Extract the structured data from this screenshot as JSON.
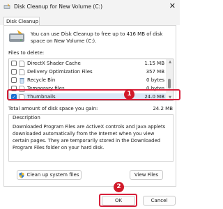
{
  "window": {
    "title": "Disk Cleanup for New Volume (C:)",
    "close_glyph": "✕"
  },
  "tabs": [
    {
      "label": "Disk Cleanup"
    }
  ],
  "intro_text": "You can use Disk Cleanup to free up to 416 MB of disk space on New Volume (C:).",
  "files_label": "Files to delete:",
  "files": [
    {
      "name": "DirectX Shader Cache",
      "size": "1.15 MB",
      "checked": false,
      "icon": "file-icon"
    },
    {
      "name": "Delivery Optimization Files",
      "size": "357 MB",
      "checked": false,
      "icon": "file-icon"
    },
    {
      "name": "Recycle Bin",
      "size": "0 bytes",
      "checked": false,
      "icon": "recycle-bin-icon"
    },
    {
      "name": "Temporary files",
      "size": "0 bytes",
      "checked": false,
      "icon": "file-icon"
    },
    {
      "name": "Thumbnails",
      "size": "24.0 MB",
      "checked": true,
      "icon": "file-icon"
    }
  ],
  "check_glyph": "✓",
  "scroll_up_glyph": "▲",
  "scroll_down_glyph": "▼",
  "total": {
    "label": "Total amount of disk space you gain:",
    "value": "24.2 MB"
  },
  "description": {
    "title": "Description",
    "text": "Downloaded Program Files are ActiveX controls and Java applets downloaded automatically from the Internet when you view certain pages. They are temporarily stored in the Downloaded Program Files folder on your hard disk."
  },
  "buttons": {
    "cleanup_system": "Clean up system files",
    "view_files": "View Files",
    "ok": "OK",
    "cancel": "Cancel"
  },
  "markers": {
    "first": "1",
    "second": "2"
  },
  "colors": {
    "accent": "#1a6fd1",
    "highlight": "#d61f3a",
    "marker": "#d11a2a"
  }
}
